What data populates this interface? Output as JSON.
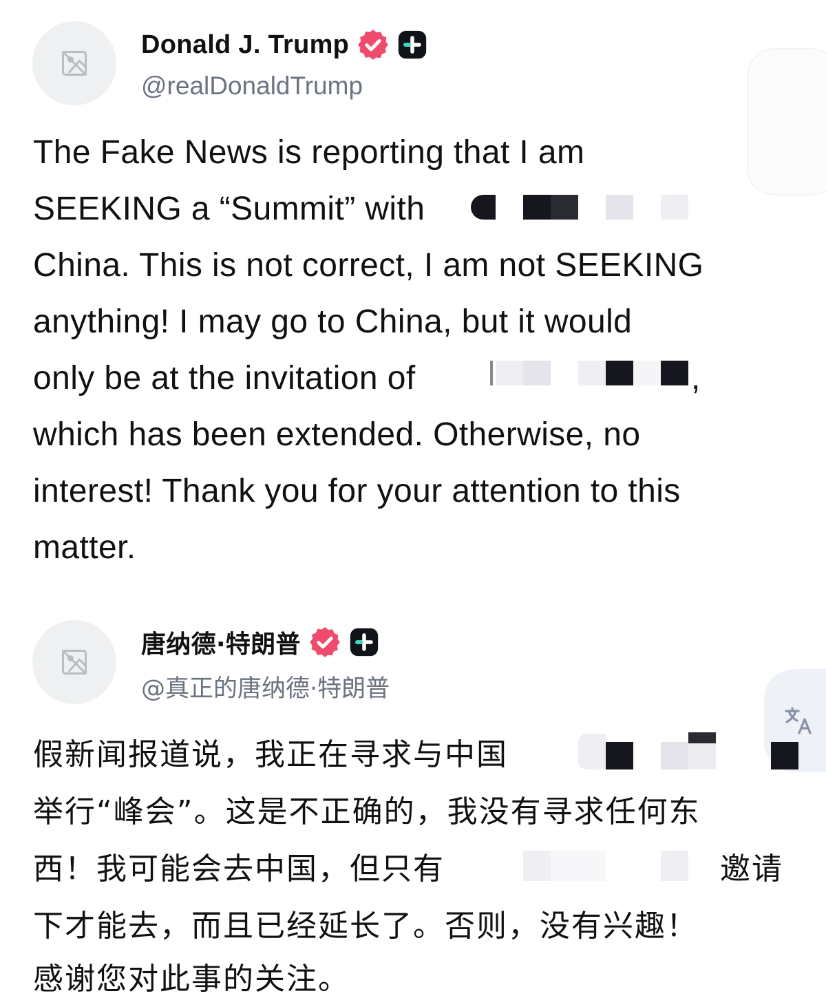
{
  "post_en": {
    "display_name": "Donald J. Trump",
    "handle": "@realDonaldTrump",
    "lines": [
      "The Fake News is reporting that I am",
      "SEEKING a “Summit” with",
      "China. This is not correct, I am not SEEKING",
      "anything! I may go to China, but it would",
      "only be at the invitation of",
      ",",
      "which has been extended. Otherwise, no",
      "interest! Thank you for your attention to this",
      "matter."
    ]
  },
  "post_zh": {
    "display_name": "唐纳德·特朗普",
    "handle": "@真正的唐纳德·特朗普",
    "lines": [
      "假新闻报道说，我正在寻求与中国",
      "举行“峰会”。这是不正确的，我没有寻求任何东",
      "西！我可能会去中国，但只有",
      "邀请",
      "下才能去，而且已经延长了。否则，没有兴趣！",
      "感谢您对此事的关注。"
    ]
  },
  "icons": {
    "avatar": "image-placeholder-icon",
    "verified": "verified-badge-icon",
    "plus": "plus-badge-icon",
    "translate": "translate-icon"
  },
  "colors": {
    "verified_badge": "#ef4b6c",
    "handle_text": "#6b7280",
    "body_text": "#111111",
    "avatar_bg": "#eef0f2"
  }
}
